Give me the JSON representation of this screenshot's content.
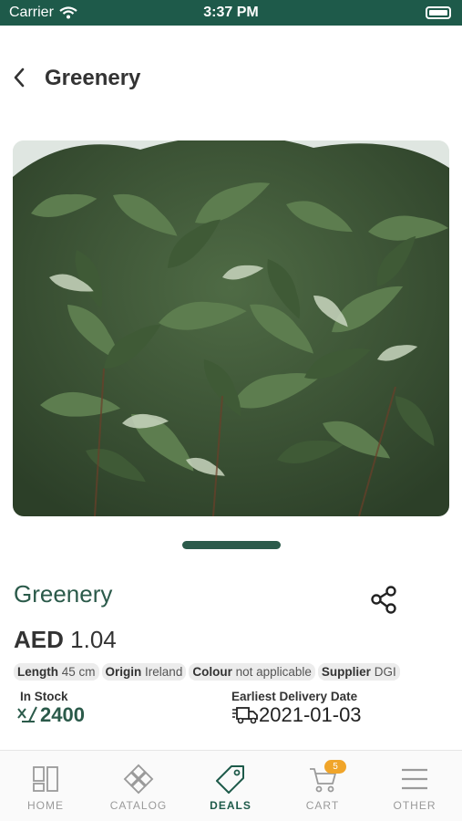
{
  "status_bar": {
    "carrier": "Carrier",
    "time": "3:37 PM"
  },
  "header": {
    "title": "Greenery"
  },
  "product": {
    "name": "Greenery",
    "price": {
      "currency": "AED",
      "amount": "1.04"
    },
    "attributes": [
      {
        "key": "Length",
        "value": "45 cm"
      },
      {
        "key": "Origin",
        "value": "Ireland"
      },
      {
        "key": "Colour",
        "value": "not applicable"
      },
      {
        "key": "Supplier",
        "value": "DGI"
      }
    ],
    "stock": {
      "label": "In Stock",
      "value": "2400"
    },
    "delivery": {
      "label": "Earliest Delivery Date",
      "value": "2021-01-03"
    }
  },
  "tabs": [
    {
      "label": "HOME",
      "icon": "home-grid-icon",
      "active": false
    },
    {
      "label": "CATALOG",
      "icon": "catalog-flower-icon",
      "active": false
    },
    {
      "label": "DEALS",
      "icon": "deals-tag-icon",
      "active": true
    },
    {
      "label": "CART",
      "icon": "cart-icon",
      "active": false,
      "badge": "5"
    },
    {
      "label": "OTHER",
      "icon": "menu-icon",
      "active": false
    }
  ],
  "colors": {
    "brand": "#1e5a4a",
    "accent": "#2b5a4a",
    "badge": "#f0a52a"
  }
}
